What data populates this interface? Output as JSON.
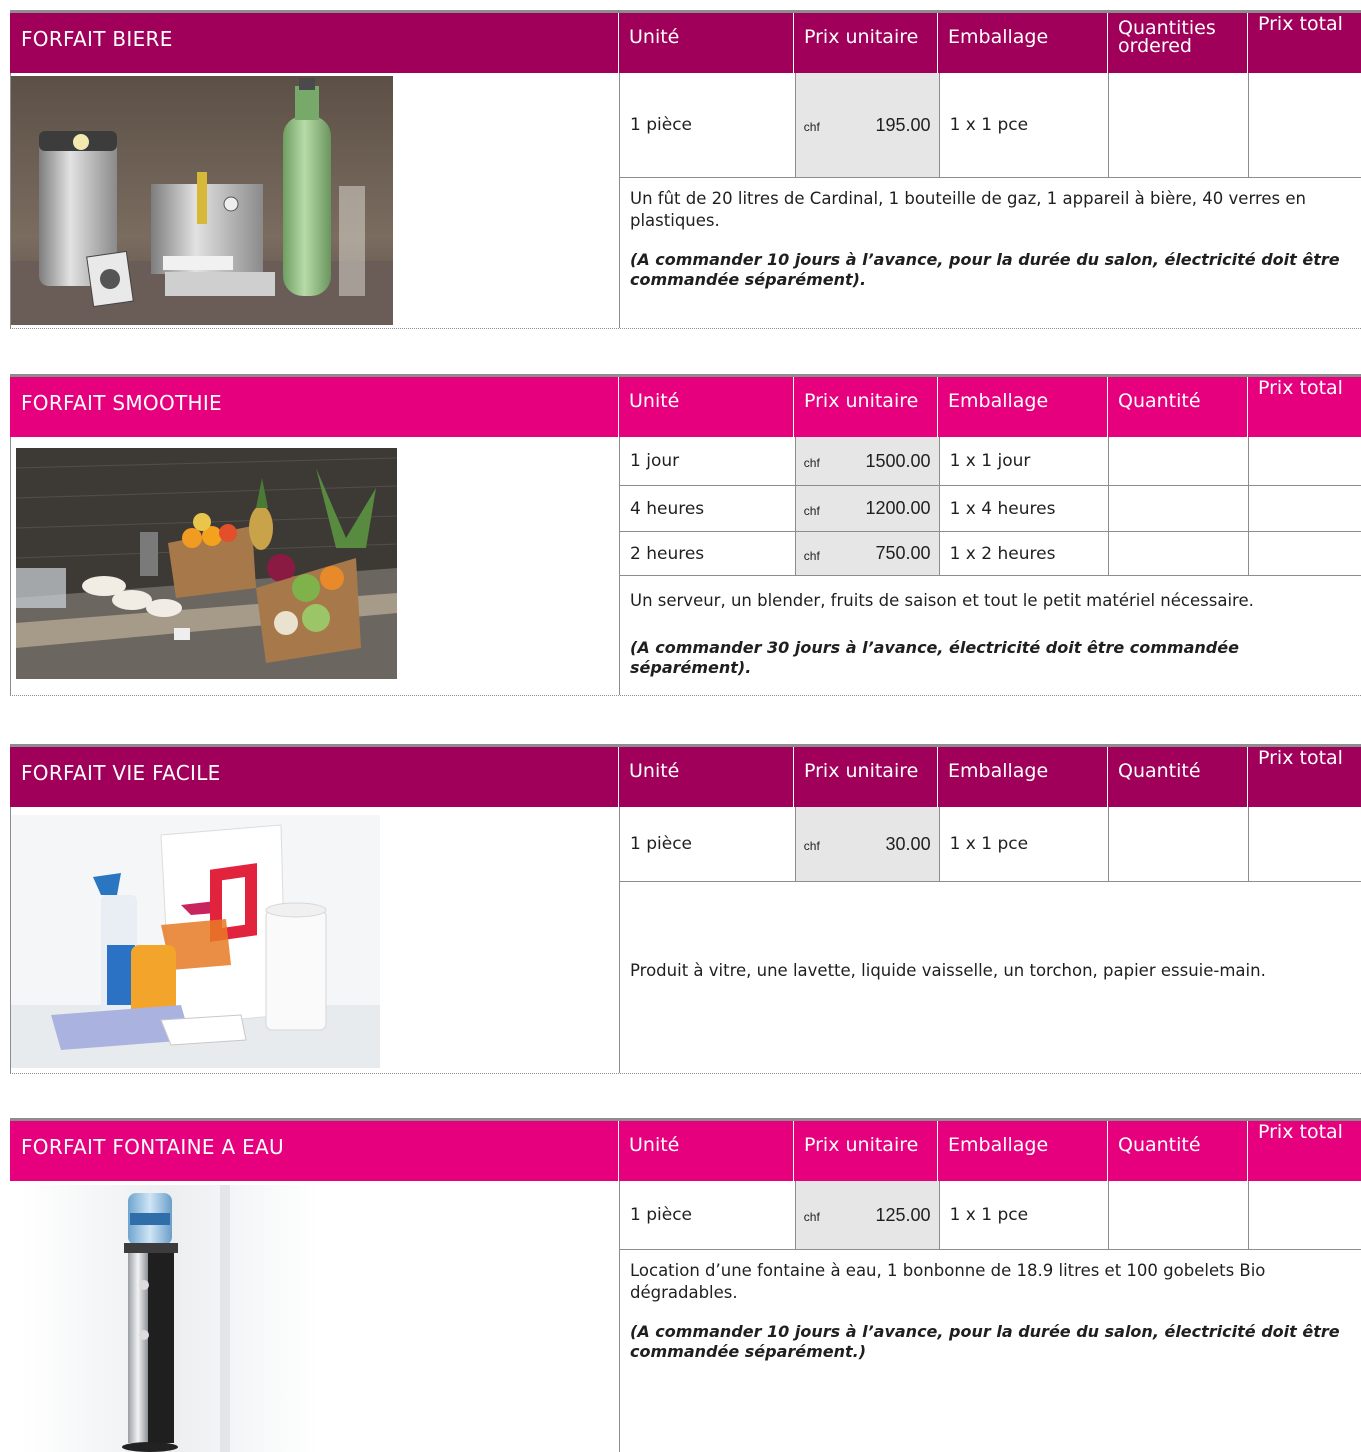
{
  "sections": [
    {
      "title": "FORFAIT BIERE",
      "header_color": "#a0005a",
      "columns": {
        "unit": "Unité",
        "price": "Prix unitaire",
        "packaging": "Emballage",
        "quantity": "Quantities ordered",
        "total": "Prix total"
      },
      "rows": [
        {
          "unit": "1 pièce",
          "currency": "chf",
          "price": "195.00",
          "packaging": "1 x 1 pce"
        }
      ],
      "description": "Un fût de 20 litres de Cardinal, 1 bouteille de gaz, 1 appareil à bière, 40 verres en plastiques.",
      "note": "(A commander 10 jours à l’avance, pour la durée du salon, électricité doit être commandée séparément).",
      "image_icon": "beer-kit-photo"
    },
    {
      "title": "FORFAIT SMOOTHIE",
      "header_color": "#e6007e",
      "columns": {
        "unit": "Unité",
        "price": "Prix unitaire",
        "packaging": "Emballage",
        "quantity": "Quantité",
        "total": "Prix total"
      },
      "rows": [
        {
          "unit": "1 jour",
          "currency": "chf",
          "price": "1500.00",
          "packaging": "1 x 1 jour"
        },
        {
          "unit": "4 heures",
          "currency": "chf",
          "price": "1200.00",
          "packaging": "1 x 4 heures"
        },
        {
          "unit": "2 heures",
          "currency": "chf",
          "price": "750.00",
          "packaging": "1 x 2 heures"
        }
      ],
      "description": "Un serveur, un blender, fruits de saison et tout le petit matériel nécessaire.",
      "note": "(A commander 30 jours à l’avance, électricité doit être commandée séparément).",
      "image_icon": "smoothie-bar-photo"
    },
    {
      "title": "FORFAIT VIE FACILE",
      "header_color": "#a0005a",
      "columns": {
        "unit": "Unité",
        "price": "Prix unitaire",
        "packaging": "Emballage",
        "quantity": "Quantité",
        "total": "Prix total"
      },
      "rows": [
        {
          "unit": "1 pièce",
          "currency": "chf",
          "price": "30.00",
          "packaging": "1 x 1 pce"
        }
      ],
      "description": "Produit à vitre, une lavette, liquide vaisselle, un torchon, papier essuie-main.",
      "image_icon": "cleaning-kit-photo"
    },
    {
      "title": "FORFAIT FONTAINE A EAU",
      "header_color": "#e6007e",
      "columns": {
        "unit": "Unité",
        "price": "Prix unitaire",
        "packaging": "Emballage",
        "quantity": "Quantité",
        "total": "Prix total"
      },
      "rows": [
        {
          "unit": "1 pièce",
          "currency": "chf",
          "price": "125.00",
          "packaging": "1 x 1 pce"
        }
      ],
      "description": "Location d’une fontaine à eau, 1 bonbonne de 18.9 litres et 100 gobelets Bio dégradables.",
      "note": "(A commander 10 jours à l’avance, pour la durée du salon, électricité doit être commandée séparément.)",
      "image_icon": "water-fountain-photo"
    }
  ]
}
